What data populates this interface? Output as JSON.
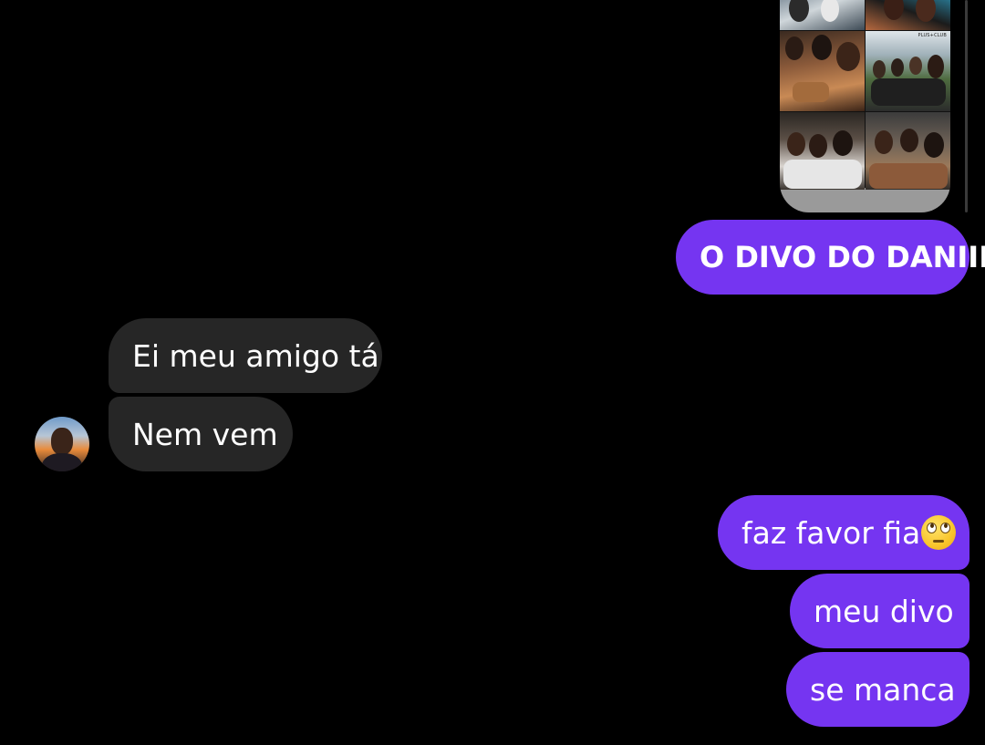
{
  "shared_post": {
    "icon": "photo-collage",
    "watermark": "PLUS+CLUB",
    "colors": {
      "card_footer": "#9a9a9a"
    }
  },
  "messages": [
    {
      "id": "divo",
      "side": "outgoing",
      "text": "O DIVO DO DANIII"
    },
    {
      "id": "ei",
      "side": "incoming",
      "text": "Ei meu amigo tá"
    },
    {
      "id": "nem",
      "side": "incoming",
      "text": "Nem vem"
    },
    {
      "id": "faz",
      "side": "outgoing",
      "text": "faz favor fia",
      "emoji": "face-with-rolling-eyes"
    },
    {
      "id": "meu",
      "side": "outgoing",
      "text": "meu divo"
    },
    {
      "id": "se",
      "side": "outgoing",
      "text": "se manca"
    }
  ],
  "contact": {
    "avatar_icon": "contact-avatar"
  },
  "colors": {
    "background": "#000000",
    "outgoing_bubble": "#7535f1",
    "incoming_bubble": "#262626",
    "text": "#ffffff"
  }
}
